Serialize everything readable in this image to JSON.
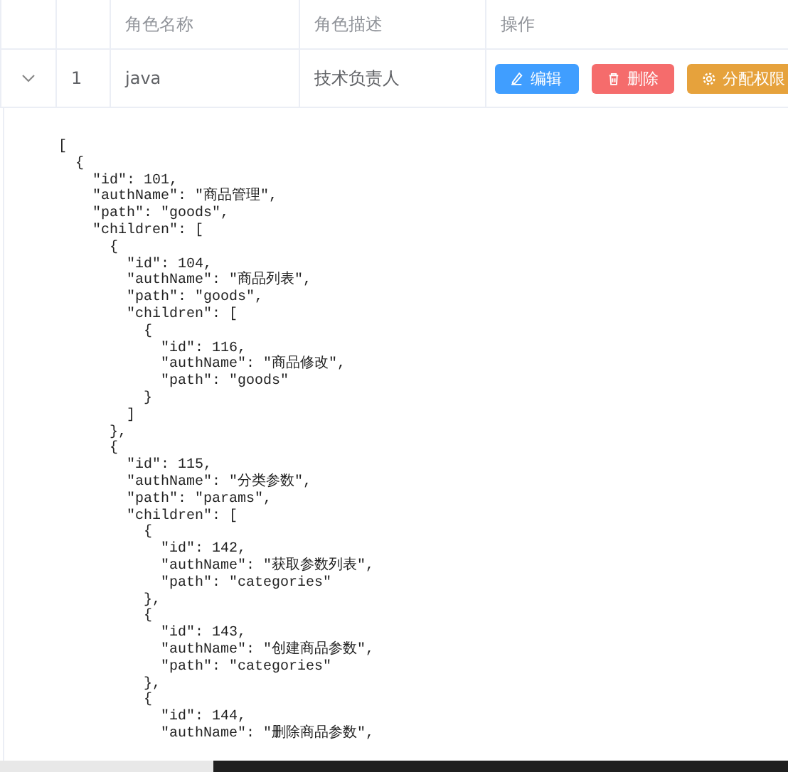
{
  "table": {
    "columns": [
      "角色名称",
      "角色描述",
      "操作"
    ],
    "rows": [
      {
        "expanded": true,
        "index": "1",
        "name": "java",
        "description": "技术负责人",
        "actions": [
          {
            "kind": "edit",
            "label": "编辑"
          },
          {
            "kind": "delete",
            "label": "删除"
          },
          {
            "kind": "assign",
            "label": "分配权限"
          }
        ],
        "detail_lines": [
          "[",
          "  {",
          "    \"id\": 101,",
          "    \"authName\": \"商品管理\",",
          "    \"path\": \"goods\",",
          "    \"children\": [",
          "      {",
          "        \"id\": 104,",
          "        \"authName\": \"商品列表\",",
          "        \"path\": \"goods\",",
          "        \"children\": [",
          "          {",
          "            \"id\": 116,",
          "            \"authName\": \"商品修改\",",
          "            \"path\": \"goods\"",
          "          }",
          "        ]",
          "      },",
          "      {",
          "        \"id\": 115,",
          "        \"authName\": \"分类参数\",",
          "        \"path\": \"params\",",
          "        \"children\": [",
          "          {",
          "            \"id\": 142,",
          "            \"authName\": \"获取参数列表\",",
          "            \"path\": \"categories\"",
          "          },",
          "          {",
          "            \"id\": 143,",
          "            \"authName\": \"创建商品参数\",",
          "            \"path\": \"categories\"",
          "          },",
          "          {",
          "            \"id\": 144,",
          "            \"authName\": \"删除商品参数\","
        ]
      }
    ]
  }
}
